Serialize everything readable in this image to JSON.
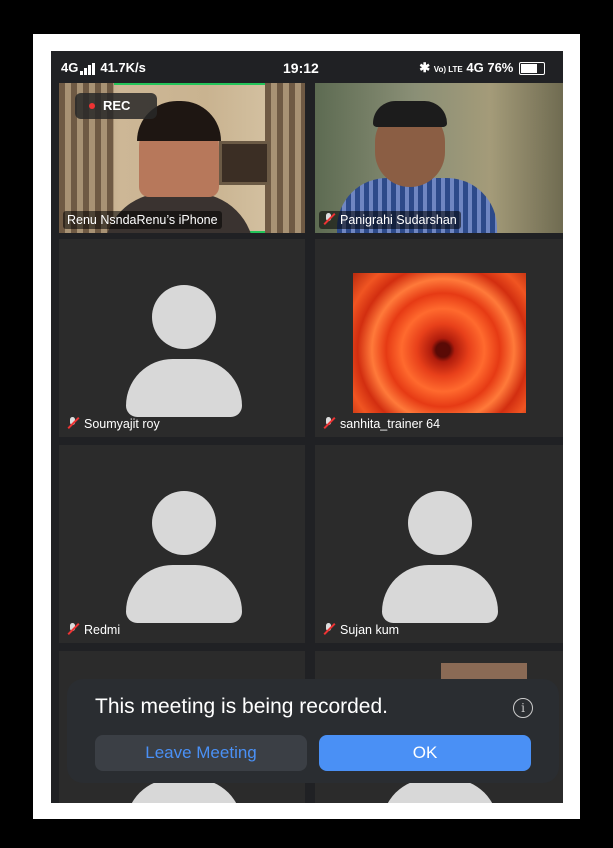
{
  "status_bar": {
    "network": "4G",
    "speed": "41.7K/s",
    "time": "19:12",
    "volte": "Vo) LTE",
    "network2": "4G",
    "battery": "76%"
  },
  "recording_indicator": "REC",
  "participants": [
    {
      "name": "Renu NsndaRenu’s iPhone",
      "muted": false
    },
    {
      "name": "Panigrahi Sudarshan",
      "muted": true
    },
    {
      "name": "Soumyajit roy",
      "muted": true
    },
    {
      "name": "sanhita_trainer 64",
      "muted": true
    },
    {
      "name": "Redmi",
      "muted": true
    },
    {
      "name": "Sujan kum",
      "muted": true
    }
  ],
  "recording_notice": {
    "message": "This meeting is being recorded.",
    "info_icon": "info-icon",
    "leave_label": "Leave Meeting",
    "ok_label": "OK"
  },
  "colors": {
    "active_speaker": "#24c45a",
    "accent": "#4a90f5",
    "background": "#202124"
  }
}
